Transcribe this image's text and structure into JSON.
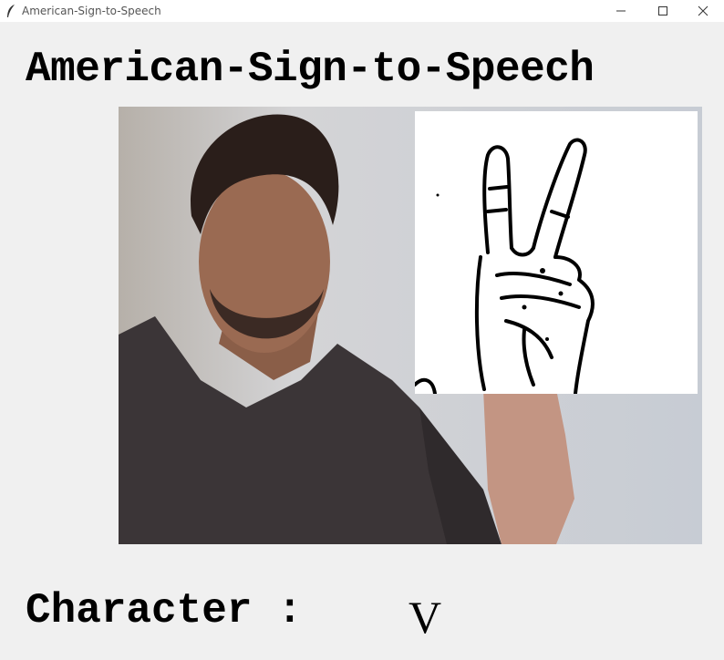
{
  "window": {
    "title": "American-Sign-to-Speech",
    "icons": [
      "feather-icon",
      "minimize-icon",
      "maximize-icon",
      "close-icon"
    ]
  },
  "app": {
    "heading": "American-Sign-to-Speech"
  },
  "camera": {
    "feed": "webcam-feed",
    "roi": "hand-threshold-roi"
  },
  "result": {
    "label": "Character :",
    "value": "V"
  }
}
